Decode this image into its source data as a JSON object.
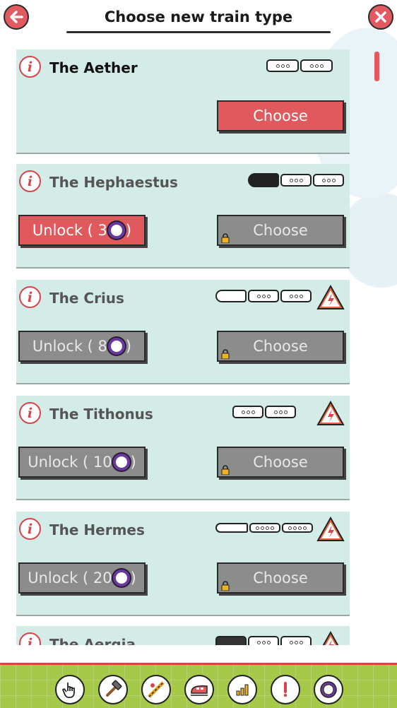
{
  "header": {
    "title": "Choose new train type",
    "back_icon": "back-arrow-icon",
    "close_icon": "close-x-icon"
  },
  "colors": {
    "accent_red": "#e05a5d",
    "card_bg": "#d4ece7",
    "locked_grey": "#8c8c8c",
    "coin_purple": "#6a3a9a",
    "bottom_bar_green": "#a6c94a"
  },
  "trains": [
    {
      "name": "The Aether",
      "info": "i",
      "unlocked": true,
      "choose_label": "Choose",
      "warning": false
    },
    {
      "name": "The Hephaestus",
      "info": "i",
      "unlocked": false,
      "unlock_label": "Unlock ( 3",
      "unlock_close": ")",
      "choose_label": "Choose",
      "warning": false
    },
    {
      "name": "The Crius",
      "info": "i",
      "unlocked": false,
      "unlock_label": "Unlock ( 8",
      "unlock_close": ")",
      "choose_label": "Choose",
      "warning": true
    },
    {
      "name": "The Tithonus",
      "info": "i",
      "unlocked": false,
      "unlock_label": "Unlock ( 10",
      "unlock_close": ")",
      "choose_label": "Choose",
      "warning": true
    },
    {
      "name": "The Hermes",
      "info": "i",
      "unlocked": false,
      "unlock_label": "Unlock ( 20",
      "unlock_close": ")",
      "choose_label": "Choose",
      "warning": true
    },
    {
      "name": "The Aergia",
      "info": "i",
      "unlocked": false,
      "warning": true
    }
  ],
  "toolbar": {
    "items": [
      "hand-pointer-icon",
      "hammer-icon",
      "track-tool-icon",
      "train-icon",
      "bar-chart-icon",
      "alert-icon",
      "coin-icon"
    ]
  }
}
